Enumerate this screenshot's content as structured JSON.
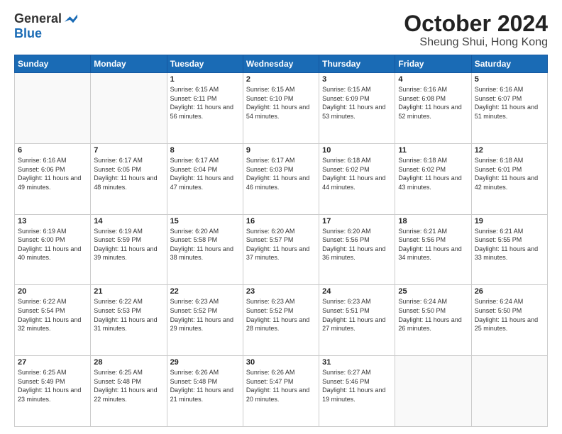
{
  "logo": {
    "general": "General",
    "blue": "Blue"
  },
  "title": "October 2024",
  "location": "Sheung Shui, Hong Kong",
  "days_of_week": [
    "Sunday",
    "Monday",
    "Tuesday",
    "Wednesday",
    "Thursday",
    "Friday",
    "Saturday"
  ],
  "weeks": [
    [
      {
        "day": "",
        "sunrise": "",
        "sunset": "",
        "daylight": "",
        "empty": true
      },
      {
        "day": "",
        "sunrise": "",
        "sunset": "",
        "daylight": "",
        "empty": true
      },
      {
        "day": "1",
        "sunrise": "Sunrise: 6:15 AM",
        "sunset": "Sunset: 6:11 PM",
        "daylight": "Daylight: 11 hours and 56 minutes.",
        "empty": false
      },
      {
        "day": "2",
        "sunrise": "Sunrise: 6:15 AM",
        "sunset": "Sunset: 6:10 PM",
        "daylight": "Daylight: 11 hours and 54 minutes.",
        "empty": false
      },
      {
        "day": "3",
        "sunrise": "Sunrise: 6:15 AM",
        "sunset": "Sunset: 6:09 PM",
        "daylight": "Daylight: 11 hours and 53 minutes.",
        "empty": false
      },
      {
        "day": "4",
        "sunrise": "Sunrise: 6:16 AM",
        "sunset": "Sunset: 6:08 PM",
        "daylight": "Daylight: 11 hours and 52 minutes.",
        "empty": false
      },
      {
        "day": "5",
        "sunrise": "Sunrise: 6:16 AM",
        "sunset": "Sunset: 6:07 PM",
        "daylight": "Daylight: 11 hours and 51 minutes.",
        "empty": false
      }
    ],
    [
      {
        "day": "6",
        "sunrise": "Sunrise: 6:16 AM",
        "sunset": "Sunset: 6:06 PM",
        "daylight": "Daylight: 11 hours and 49 minutes.",
        "empty": false
      },
      {
        "day": "7",
        "sunrise": "Sunrise: 6:17 AM",
        "sunset": "Sunset: 6:05 PM",
        "daylight": "Daylight: 11 hours and 48 minutes.",
        "empty": false
      },
      {
        "day": "8",
        "sunrise": "Sunrise: 6:17 AM",
        "sunset": "Sunset: 6:04 PM",
        "daylight": "Daylight: 11 hours and 47 minutes.",
        "empty": false
      },
      {
        "day": "9",
        "sunrise": "Sunrise: 6:17 AM",
        "sunset": "Sunset: 6:03 PM",
        "daylight": "Daylight: 11 hours and 46 minutes.",
        "empty": false
      },
      {
        "day": "10",
        "sunrise": "Sunrise: 6:18 AM",
        "sunset": "Sunset: 6:02 PM",
        "daylight": "Daylight: 11 hours and 44 minutes.",
        "empty": false
      },
      {
        "day": "11",
        "sunrise": "Sunrise: 6:18 AM",
        "sunset": "Sunset: 6:02 PM",
        "daylight": "Daylight: 11 hours and 43 minutes.",
        "empty": false
      },
      {
        "day": "12",
        "sunrise": "Sunrise: 6:18 AM",
        "sunset": "Sunset: 6:01 PM",
        "daylight": "Daylight: 11 hours and 42 minutes.",
        "empty": false
      }
    ],
    [
      {
        "day": "13",
        "sunrise": "Sunrise: 6:19 AM",
        "sunset": "Sunset: 6:00 PM",
        "daylight": "Daylight: 11 hours and 40 minutes.",
        "empty": false
      },
      {
        "day": "14",
        "sunrise": "Sunrise: 6:19 AM",
        "sunset": "Sunset: 5:59 PM",
        "daylight": "Daylight: 11 hours and 39 minutes.",
        "empty": false
      },
      {
        "day": "15",
        "sunrise": "Sunrise: 6:20 AM",
        "sunset": "Sunset: 5:58 PM",
        "daylight": "Daylight: 11 hours and 38 minutes.",
        "empty": false
      },
      {
        "day": "16",
        "sunrise": "Sunrise: 6:20 AM",
        "sunset": "Sunset: 5:57 PM",
        "daylight": "Daylight: 11 hours and 37 minutes.",
        "empty": false
      },
      {
        "day": "17",
        "sunrise": "Sunrise: 6:20 AM",
        "sunset": "Sunset: 5:56 PM",
        "daylight": "Daylight: 11 hours and 36 minutes.",
        "empty": false
      },
      {
        "day": "18",
        "sunrise": "Sunrise: 6:21 AM",
        "sunset": "Sunset: 5:56 PM",
        "daylight": "Daylight: 11 hours and 34 minutes.",
        "empty": false
      },
      {
        "day": "19",
        "sunrise": "Sunrise: 6:21 AM",
        "sunset": "Sunset: 5:55 PM",
        "daylight": "Daylight: 11 hours and 33 minutes.",
        "empty": false
      }
    ],
    [
      {
        "day": "20",
        "sunrise": "Sunrise: 6:22 AM",
        "sunset": "Sunset: 5:54 PM",
        "daylight": "Daylight: 11 hours and 32 minutes.",
        "empty": false
      },
      {
        "day": "21",
        "sunrise": "Sunrise: 6:22 AM",
        "sunset": "Sunset: 5:53 PM",
        "daylight": "Daylight: 11 hours and 31 minutes.",
        "empty": false
      },
      {
        "day": "22",
        "sunrise": "Sunrise: 6:23 AM",
        "sunset": "Sunset: 5:52 PM",
        "daylight": "Daylight: 11 hours and 29 minutes.",
        "empty": false
      },
      {
        "day": "23",
        "sunrise": "Sunrise: 6:23 AM",
        "sunset": "Sunset: 5:52 PM",
        "daylight": "Daylight: 11 hours and 28 minutes.",
        "empty": false
      },
      {
        "day": "24",
        "sunrise": "Sunrise: 6:23 AM",
        "sunset": "Sunset: 5:51 PM",
        "daylight": "Daylight: 11 hours and 27 minutes.",
        "empty": false
      },
      {
        "day": "25",
        "sunrise": "Sunrise: 6:24 AM",
        "sunset": "Sunset: 5:50 PM",
        "daylight": "Daylight: 11 hours and 26 minutes.",
        "empty": false
      },
      {
        "day": "26",
        "sunrise": "Sunrise: 6:24 AM",
        "sunset": "Sunset: 5:50 PM",
        "daylight": "Daylight: 11 hours and 25 minutes.",
        "empty": false
      }
    ],
    [
      {
        "day": "27",
        "sunrise": "Sunrise: 6:25 AM",
        "sunset": "Sunset: 5:49 PM",
        "daylight": "Daylight: 11 hours and 23 minutes.",
        "empty": false
      },
      {
        "day": "28",
        "sunrise": "Sunrise: 6:25 AM",
        "sunset": "Sunset: 5:48 PM",
        "daylight": "Daylight: 11 hours and 22 minutes.",
        "empty": false
      },
      {
        "day": "29",
        "sunrise": "Sunrise: 6:26 AM",
        "sunset": "Sunset: 5:48 PM",
        "daylight": "Daylight: 11 hours and 21 minutes.",
        "empty": false
      },
      {
        "day": "30",
        "sunrise": "Sunrise: 6:26 AM",
        "sunset": "Sunset: 5:47 PM",
        "daylight": "Daylight: 11 hours and 20 minutes.",
        "empty": false
      },
      {
        "day": "31",
        "sunrise": "Sunrise: 6:27 AM",
        "sunset": "Sunset: 5:46 PM",
        "daylight": "Daylight: 11 hours and 19 minutes.",
        "empty": false
      },
      {
        "day": "",
        "sunrise": "",
        "sunset": "",
        "daylight": "",
        "empty": true
      },
      {
        "day": "",
        "sunrise": "",
        "sunset": "",
        "daylight": "",
        "empty": true
      }
    ]
  ]
}
